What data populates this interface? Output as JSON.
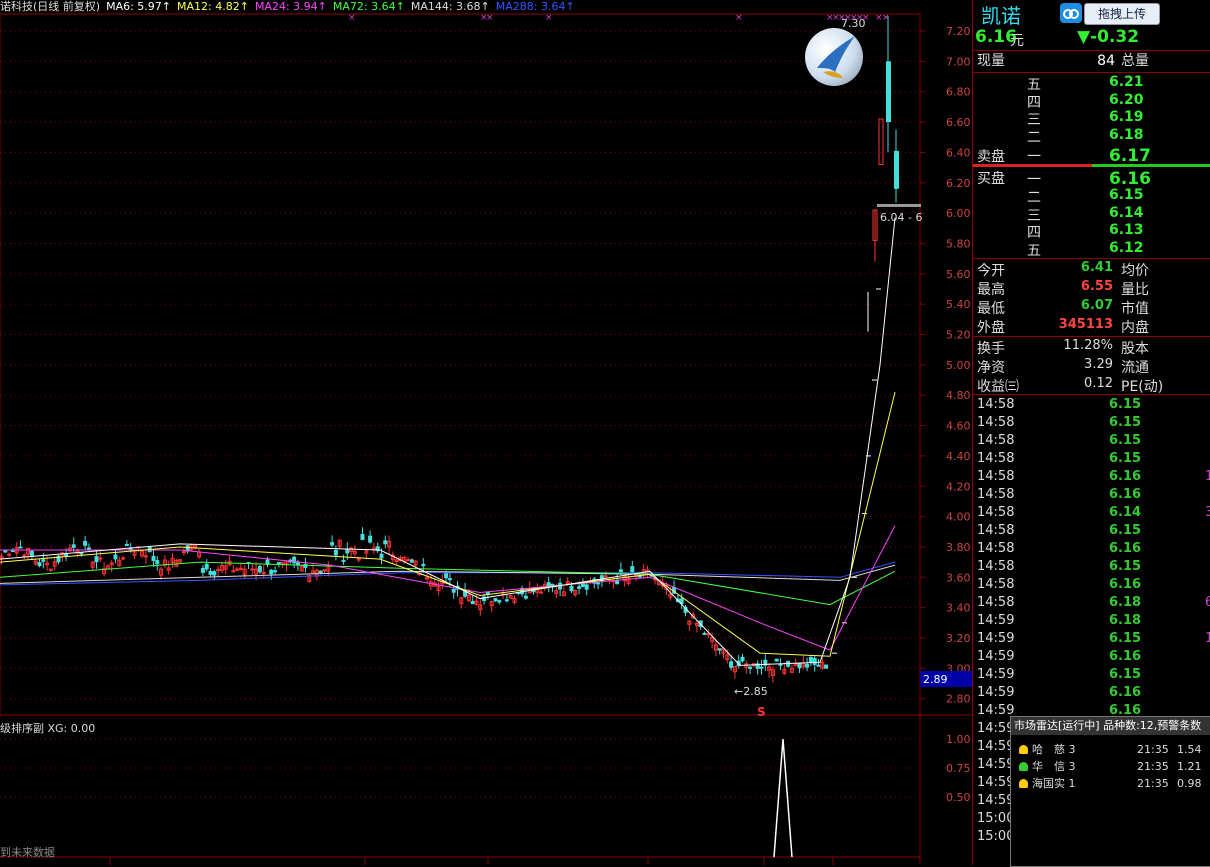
{
  "header": {
    "stock": "诺科技(日线 前复权)",
    "ma": [
      {
        "label": "MA6: 5.97↑",
        "color": "#ffffff"
      },
      {
        "label": "MA12: 4.82↑",
        "color": "#ffff55"
      },
      {
        "label": "MA24: 3.94↑",
        "color": "#ff44ff"
      },
      {
        "label": "MA72: 3.64↑",
        "color": "#44ff44"
      },
      {
        "label": "MA144: 3.68↑",
        "color": "#dddddd"
      },
      {
        "label": "MA288: 3.64↑",
        "color": "#3355ff"
      }
    ]
  },
  "sub": {
    "title": "级排序副  XG: 0.00",
    "future_note": "到未来数据"
  },
  "price_axis": [
    "7.20",
    "7.00",
    "6.80",
    "6.60",
    "6.40",
    "6.20",
    "6.00",
    "5.80",
    "5.60",
    "5.40",
    "5.20",
    "5.00",
    "4.80",
    "4.60",
    "4.40",
    "4.20",
    "4.00",
    "3.80",
    "3.60",
    "3.40",
    "3.20",
    "3.00",
    "2.80"
  ],
  "sub_axis": [
    "1.00",
    "0.75",
    "0.50"
  ],
  "annotations": {
    "high": "7.30",
    "low": "←2.85",
    "range": "6.04 - 6",
    "price_tag": "2.89",
    "s_mark": "S"
  },
  "panel": {
    "brand": "凯诺",
    "upload": "拖拽上传",
    "price": "6.16",
    "unit": "元",
    "change": "▼-0.32",
    "vol_label": "现量",
    "vol_value": "84",
    "total_label": "总量",
    "sell_label": "卖盘",
    "buy_label": "买盘",
    "sell": [
      {
        "lvl": "五",
        "price": "6.21"
      },
      {
        "lvl": "四",
        "price": "6.20"
      },
      {
        "lvl": "三",
        "price": "6.19"
      },
      {
        "lvl": "二",
        "price": "6.18"
      },
      {
        "lvl": "一",
        "price": "6.17"
      }
    ],
    "buy": [
      {
        "lvl": "一",
        "price": "6.16"
      },
      {
        "lvl": "二",
        "price": "6.15"
      },
      {
        "lvl": "三",
        "price": "6.14"
      },
      {
        "lvl": "四",
        "price": "6.13"
      },
      {
        "lvl": "五",
        "price": "6.12"
      }
    ],
    "stats": [
      {
        "l": "今开",
        "v": "6.41",
        "c": "#33cc33",
        "r": "均价"
      },
      {
        "l": "最高",
        "v": "6.55",
        "c": "#ff4444",
        "r": "量比"
      },
      {
        "l": "最低",
        "v": "6.07",
        "c": "#33cc33",
        "r": "市值"
      },
      {
        "l": "外盘",
        "v": "345113",
        "c": "#ff4444",
        "r": "内盘"
      }
    ],
    "stats2": [
      {
        "l": "换手",
        "v": "11.28%",
        "r": "股本"
      },
      {
        "l": "净资",
        "v": "3.29",
        "r": "流通"
      },
      {
        "l": "收益㈢",
        "v": "0.12",
        "r": "PE(动)"
      }
    ],
    "ticks": [
      {
        "t": "14:58",
        "p": "6.15",
        "v": ""
      },
      {
        "t": "14:58",
        "p": "6.15",
        "v": ""
      },
      {
        "t": "14:58",
        "p": "6.15",
        "v": ""
      },
      {
        "t": "14:58",
        "p": "6.15",
        "v": ""
      },
      {
        "t": "14:58",
        "p": "6.16",
        "v": "1"
      },
      {
        "t": "14:58",
        "p": "6.16",
        "v": ""
      },
      {
        "t": "14:58",
        "p": "6.14",
        "v": "3"
      },
      {
        "t": "14:58",
        "p": "6.15",
        "v": ""
      },
      {
        "t": "14:58",
        "p": "6.16",
        "v": ""
      },
      {
        "t": "14:58",
        "p": "6.15",
        "v": ""
      },
      {
        "t": "14:58",
        "p": "6.16",
        "v": ""
      },
      {
        "t": "14:58",
        "p": "6.18",
        "v": "6"
      },
      {
        "t": "14:59",
        "p": "6.18",
        "v": ""
      },
      {
        "t": "14:59",
        "p": "6.15",
        "v": "1"
      },
      {
        "t": "14:59",
        "p": "6.16",
        "v": ""
      },
      {
        "t": "14:59",
        "p": "6.15",
        "v": ""
      },
      {
        "t": "14:59",
        "p": "6.16",
        "v": ""
      },
      {
        "t": "14:59",
        "p": "6.16",
        "v": ""
      },
      {
        "t": "14:59",
        "p": "",
        "v": ""
      },
      {
        "t": "14:59",
        "p": "",
        "v": ""
      },
      {
        "t": "14:59",
        "p": "",
        "v": ""
      },
      {
        "t": "14:59",
        "p": "",
        "v": ""
      },
      {
        "t": "14:59",
        "p": "",
        "v": ""
      },
      {
        "t": "15:00",
        "p": "",
        "v": ""
      },
      {
        "t": "15:00",
        "p": "",
        "v": ""
      }
    ]
  },
  "radar": {
    "title": "市场雷达[运行中] 品种数:12,预警条数",
    "items": [
      {
        "name": "哈　慈 3",
        "time": "21:35",
        "val": "1.54",
        "bell": "#ffcc00"
      },
      {
        "name": "华　信 3",
        "time": "21:35",
        "val": "1.21",
        "bell": "#33cc33"
      },
      {
        "name": "海国实 1",
        "time": "21:35",
        "val": "0.98",
        "bell": "#ffcc00"
      }
    ]
  }
}
